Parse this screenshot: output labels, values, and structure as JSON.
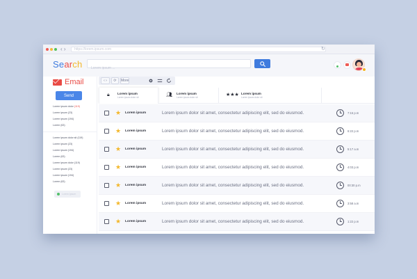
{
  "browser": {
    "url_placeholder": "https://lorem.ipsum.com",
    "nav_arrows": "‹ ›",
    "reload_icon": "↻"
  },
  "header": {
    "brand": "Search",
    "search_placeholder": "Lorem ipsum ...",
    "search_button_icon": "search-icon"
  },
  "sidebar": {
    "app_name": "Email",
    "send_label": "Send",
    "folders_primary": [
      {
        "label": "Lorem ipsum dolor",
        "count": "(119)",
        "highlight": true
      },
      {
        "label": "Lorem ipsum",
        "count": "(23)",
        "highlight": false
      },
      {
        "label": "Lorem ipsum",
        "count": "(194)",
        "highlight": false
      },
      {
        "label": "Lorem",
        "count": "(63)",
        "highlight": false
      }
    ],
    "folders_secondary": [
      {
        "label": "Lorem ipsum dolor sit",
        "count": "(119)"
      },
      {
        "label": "Lorem ipsum",
        "count": "(23)"
      },
      {
        "label": "Lorem ipsum",
        "count": "(194)"
      },
      {
        "label": "Lorem",
        "count": "(63)"
      },
      {
        "label": "Lorem ipsum dolor",
        "count": "(119)"
      },
      {
        "label": "Lorem ipsum",
        "count": "(23)"
      },
      {
        "label": "Lorem ipsum",
        "count": "(194)"
      },
      {
        "label": "Lorem",
        "count": "(63)"
      }
    ],
    "status_label": "Lorem ipsum"
  },
  "toolbar": {
    "back_label": "‹ ›",
    "forward_label": "⟳",
    "more_label": "More"
  },
  "tabs": [
    {
      "title": "Lorem ipsum",
      "subtitle": "Lorem ipsum dolor sit",
      "icon": "bag-icon",
      "glyph": "🔒︎"
    },
    {
      "title": "Lorem ipsum",
      "subtitle": "Lorem ipsum dolor sit",
      "icon": "people-icon",
      "glyph": "👥︎"
    },
    {
      "title": "Lorem ipsum",
      "subtitle": "Lorem ipsum dolor sit",
      "icon": "stars-icon",
      "glyph": "★★★"
    }
  ],
  "emails": [
    {
      "sender": "Lorem ipsum",
      "preview": "Lorem ipsum dolor sit amet, consectetur adipiscing elit, sed do eiusmod.",
      "time": "7:15 p.m"
    },
    {
      "sender": "Lorem ipsum",
      "preview": "Lorem ipsum dolor sit amet, consectetur adipiscing elit, sed do eiusmod.",
      "time": "6:22 p.m"
    },
    {
      "sender": "Lorem ipsum",
      "preview": "Lorem ipsum dolor sit amet, consectetur adipiscing elit, sed do eiusmod.",
      "time": "5:17 a.m"
    },
    {
      "sender": "Lorem ipsum",
      "preview": "Lorem ipsum dolor sit amet, consectetur adipiscing elit, sed do eiusmod.",
      "time": "4:03 p.m"
    },
    {
      "sender": "Lorem ipsum",
      "preview": "Lorem ipsum dolor sit amet, consectetur adipiscing elit, sed do eiusmod.",
      "time": "00:30 p.m"
    },
    {
      "sender": "Lorem ipsum",
      "preview": "Lorem ipsum dolor sit amet, consectetur adipiscing elit, sed do eiusmod.",
      "time": "3:58 a.m"
    },
    {
      "sender": "Lorem ipsum",
      "preview": "Lorem ipsum dolor sit amet, consectetur adipiscing elit, sed do eiusmod.",
      "time": "1:22 p.m"
    }
  ],
  "colors": {
    "brand_search": [
      "#3f7bde",
      "#e94b45",
      "#f3b72a",
      "#53c06a"
    ],
    "accent": "#4a86e8",
    "email_red": "#e94b45",
    "star": "#f3b72a",
    "background": "#c5d0e4"
  }
}
